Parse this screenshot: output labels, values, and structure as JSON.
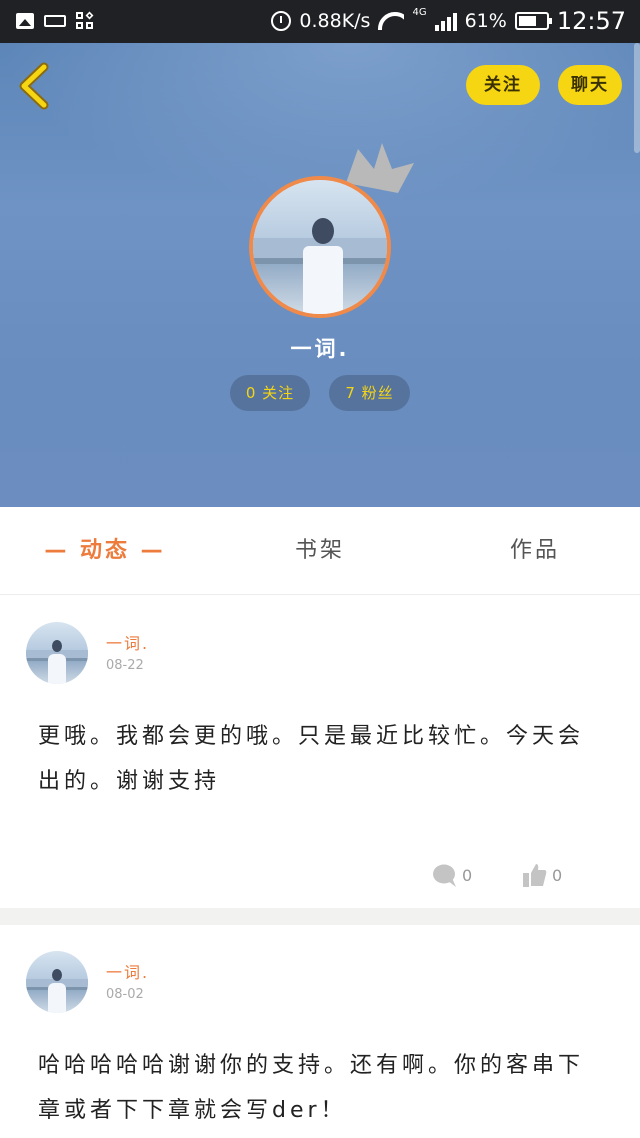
{
  "status_bar": {
    "speed": "0.88K/s",
    "network": "4G",
    "battery": "61%",
    "time": "12:57"
  },
  "header": {
    "follow_button": "关注",
    "chat_button": "聊天",
    "username": "一词.",
    "stats": {
      "following": "0 关注",
      "fans": "7 粉丝"
    }
  },
  "tabs": [
    {
      "label": "— 动态 —",
      "active": true
    },
    {
      "label": "书架",
      "active": false
    },
    {
      "label": "作品",
      "active": false
    }
  ],
  "posts": [
    {
      "author": "一词.",
      "date": "08-22",
      "text": "更哦。我都会更的哦。只是最近比较忙。今天会出的。谢谢支持",
      "comments": "0",
      "likes": "0"
    },
    {
      "author": "一词.",
      "date": "08-02",
      "text": "哈哈哈哈哈谢谢你的支持。还有啊。你的客串下章或者下下章就会写der！"
    }
  ],
  "colors": {
    "accent": "#ec7b3c",
    "button_yellow": "#f6d512",
    "header_blue": "#6a8dbf"
  }
}
